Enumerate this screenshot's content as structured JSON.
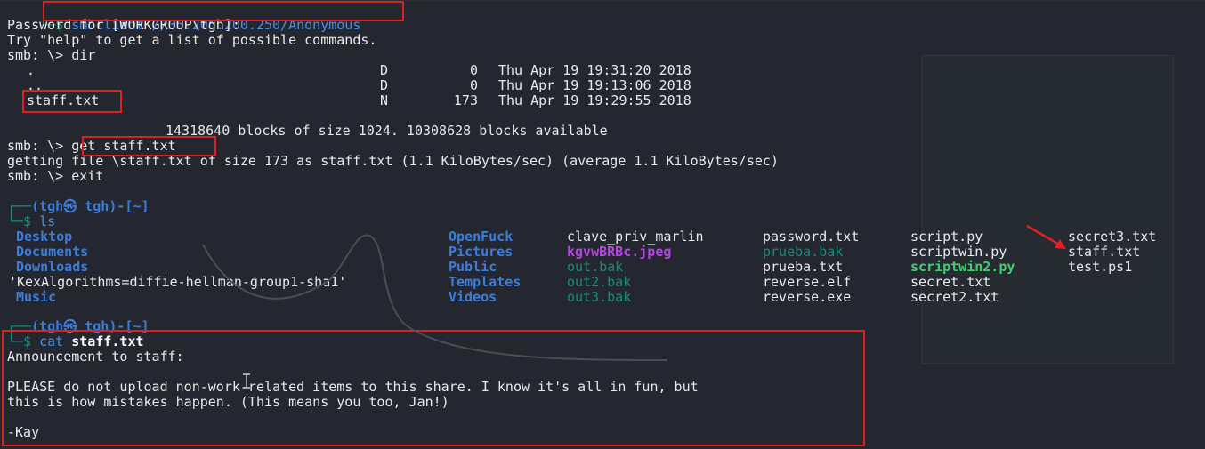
{
  "prompt1": "smbclient //35.205.200.250/Anonymous",
  "password_line": "Password for [WORKGROUP\\tgh]:",
  "help_line": "Try \"help\" to get a list of possible commands.",
  "smb_dir": "smb: \\> dir",
  "dir_entries": [
    {
      "name": ".",
      "attr": "D",
      "size": "0",
      "date": "Thu Apr 19 19:31:20 2018"
    },
    {
      "name": "..",
      "attr": "D",
      "size": "0",
      "date": "Thu Apr 19 19:13:06 2018"
    },
    {
      "name": "staff.txt",
      "attr": "N",
      "size": "173",
      "date": "Thu Apr 19 19:29:55 2018"
    }
  ],
  "blocks_line": "14318640 blocks of size 1024. 10308628 blocks available",
  "smb_get_prompt": "smb: \\> ",
  "smb_get_cmd": "get staff.txt",
  "getting_line": "getting file \\staff.txt of size 173 as staff.txt (1.1 KiloBytes/sec) (average 1.1 KiloBytes/sec)",
  "smb_exit": "smb: \\> exit",
  "prompt_header": "(tgh㉿ tgh)-[~]",
  "ls_cmd": "ls",
  "ls_columns": [
    [
      "Desktop",
      "Documents",
      "Downloads",
      "'KexAlgorithms=diffie-hellman-group1-sha1'",
      "Music"
    ],
    [
      "OpenFuck",
      "Pictures",
      "Public",
      "Templates",
      "Videos"
    ],
    [
      "clave_priv_marlin",
      "kgvwBRBc.jpeg",
      "out.bak",
      "out2.bak",
      "out3.bak"
    ],
    [
      "password.txt",
      "prueba.bak",
      "prueba.txt",
      "reverse.elf",
      "reverse.exe"
    ],
    [
      "script.py",
      "scriptwin.py",
      "scriptwin2.py",
      "secret.txt",
      "secret2.txt"
    ],
    [
      "secret3.txt",
      "staff.txt",
      "test.ps1"
    ]
  ],
  "prompt_header2": "(tgh㉿ tgh)-[~]",
  "cat_cmd": "cat",
  "cat_arg": "staff.txt",
  "file_lines": [
    "Announcement to staff:",
    "",
    "PLEASE do not upload non-work-related items to this share. I know it's all in fun, but",
    "this is how mistakes happen. (This means you too, Jan!)",
    "",
    "-Kay"
  ],
  "colors": {
    "background": "#24272f",
    "highlight_box": "#e02020",
    "prompt_blue": "#3b7ddd"
  }
}
